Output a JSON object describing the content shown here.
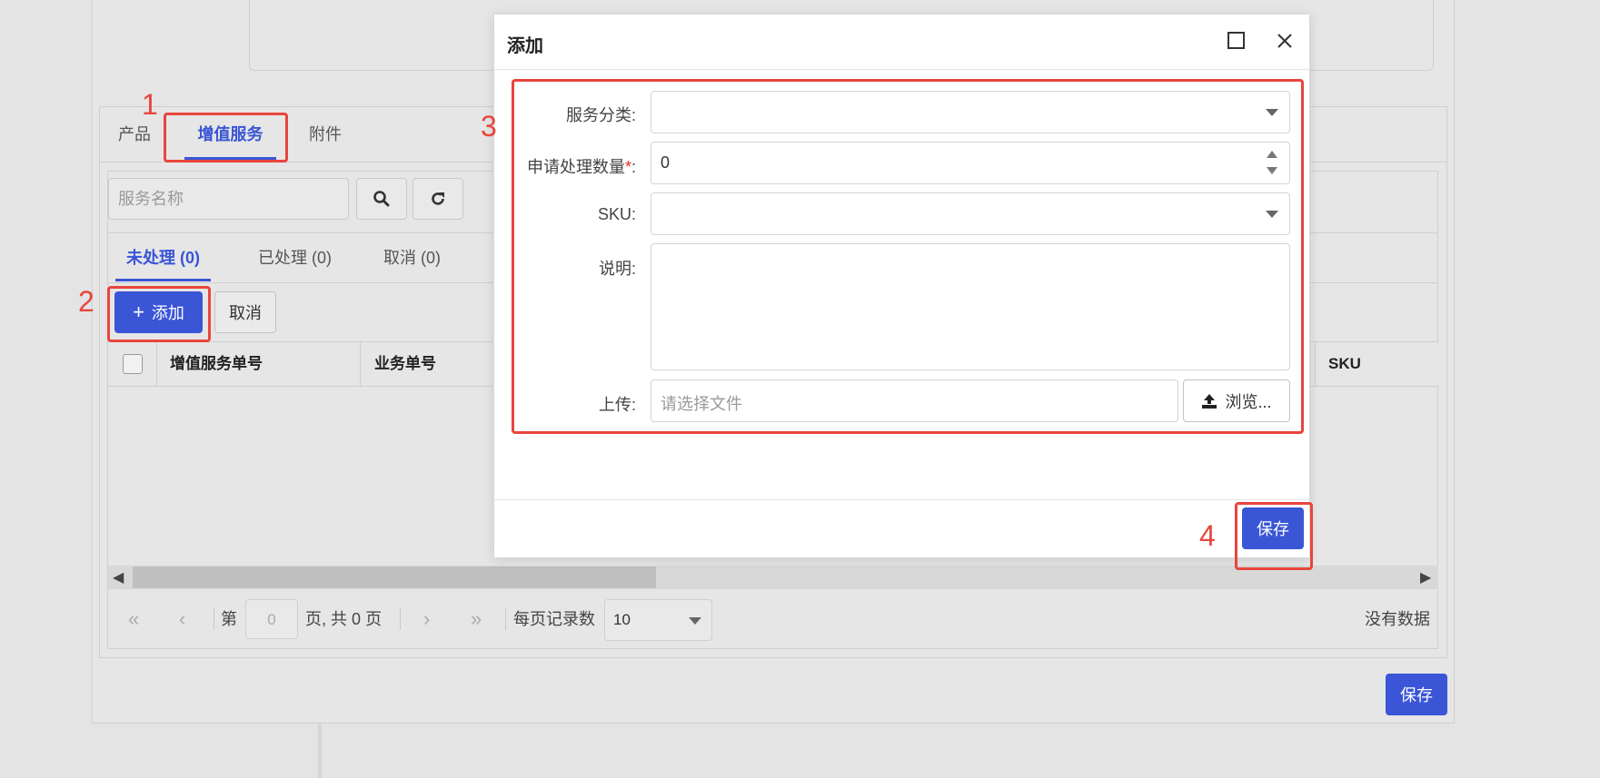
{
  "background": {
    "tabs": [
      {
        "label": "产品",
        "active": false
      },
      {
        "label": "增值服务",
        "active": true
      },
      {
        "label": "附件",
        "active": false
      }
    ],
    "search": {
      "placeholder": "服务名称"
    },
    "subtabs": [
      {
        "label": "未处理 (0)",
        "active": true
      },
      {
        "label": "已处理 (0)",
        "active": false
      },
      {
        "label": "取消 (0)",
        "active": false
      }
    ],
    "toolbar": {
      "add_label": "添加",
      "cancel_label": "取消"
    },
    "table": {
      "columns": [
        "增值服务单号",
        "业务单号",
        "SKU"
      ]
    },
    "pager": {
      "page_prefix": "第",
      "page_value": "0",
      "page_suffix": "页, 共",
      "total_pages": "0",
      "total_suffix": "页",
      "per_page_label": "每页记录数",
      "per_page_value": "10",
      "empty_text": "没有数据"
    },
    "save_label": "保存"
  },
  "modal": {
    "title": "添加",
    "fields": {
      "service_category": {
        "label": "服务分类:",
        "value": ""
      },
      "quantity": {
        "label": "申请处理数量",
        "required_mark": "*",
        "colon": ":",
        "value": "0"
      },
      "sku": {
        "label": "SKU:",
        "value": ""
      },
      "description": {
        "label": "说明:",
        "value": ""
      },
      "upload": {
        "label": "上传:",
        "placeholder": "请选择文件",
        "browse_label": "浏览..."
      }
    },
    "save_label": "保存"
  },
  "annotations": [
    "1",
    "2",
    "3",
    "4"
  ],
  "colors": {
    "primary": "#3a55d6",
    "annotation_red": "#e8453c",
    "required_red": "#e02a2a"
  }
}
